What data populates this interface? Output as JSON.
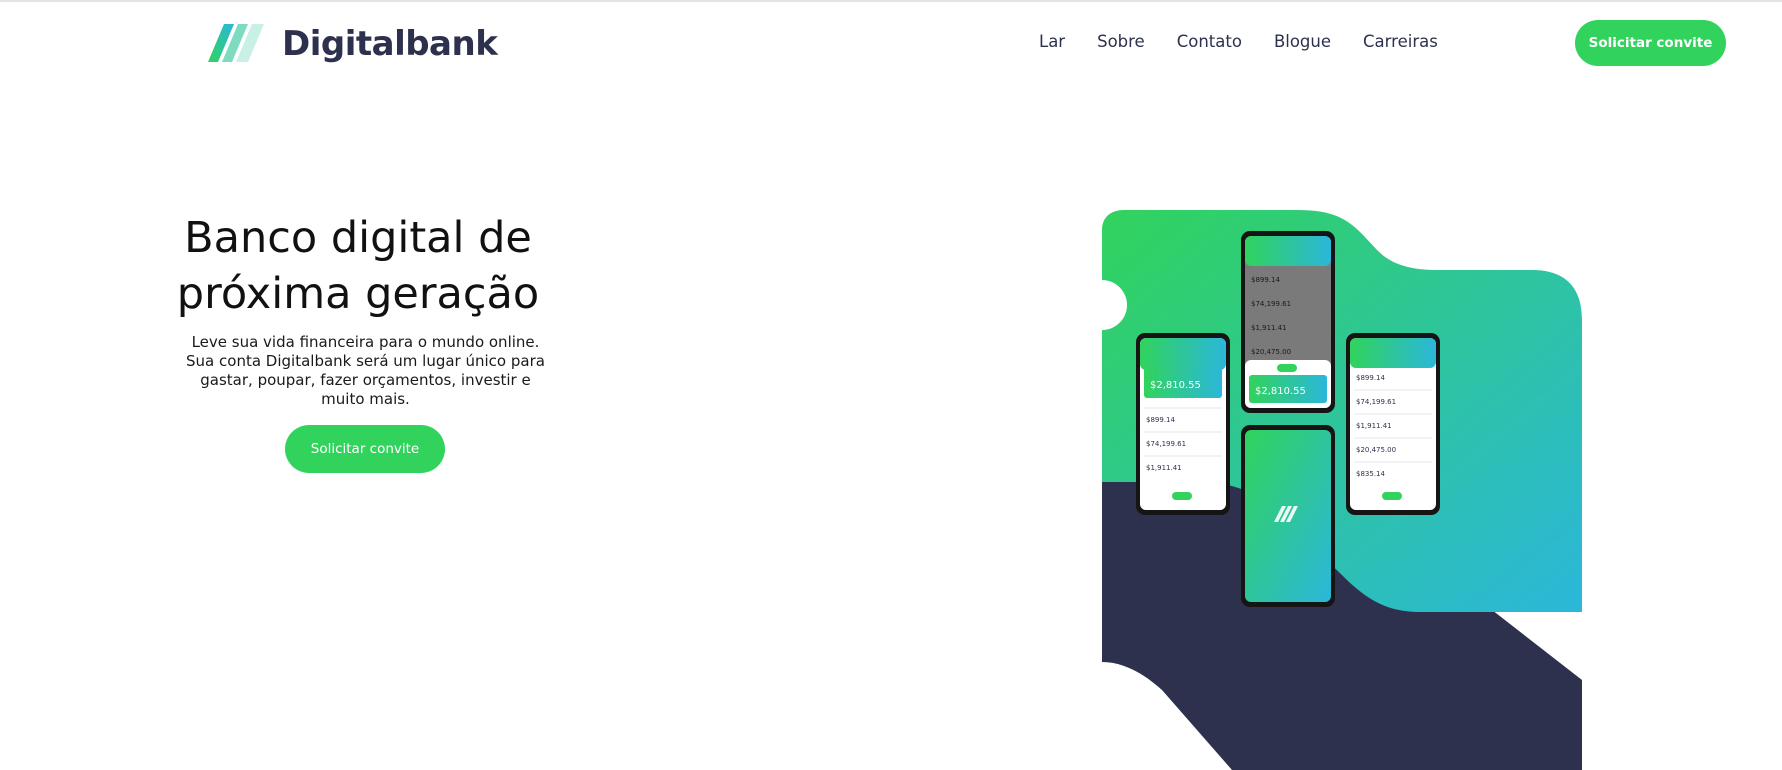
{
  "brand": {
    "name": "Digitalbank",
    "colors": {
      "primary_green": "#31d35c",
      "accent_cyan": "#2bb7da",
      "dark_navy": "#2d314d",
      "background": "#ffffff"
    },
    "logo_icon": "diagonal-stripes-logo"
  },
  "nav": {
    "items": [
      {
        "label": "Lar"
      },
      {
        "label": "Sobre"
      },
      {
        "label": "Contato"
      },
      {
        "label": "Blogue"
      },
      {
        "label": "Carreiras"
      }
    ],
    "cta_label": "Solicitar convite"
  },
  "hero": {
    "title": "Banco digital de próxima geração",
    "description": "Leve sua vida financeira para o mundo online. Sua conta Digitalbank será um lugar único para gastar, poupar, fazer orçamentos, investir e muito mais.",
    "cta_label": "Solicitar convite"
  },
  "illustration": {
    "icon": "phone-mockups-image",
    "balance": "$2,810.55",
    "transactions": [
      "$899.14",
      "$74,199.61",
      "$1,911.41",
      "$20,475.00",
      "$835.14"
    ]
  }
}
